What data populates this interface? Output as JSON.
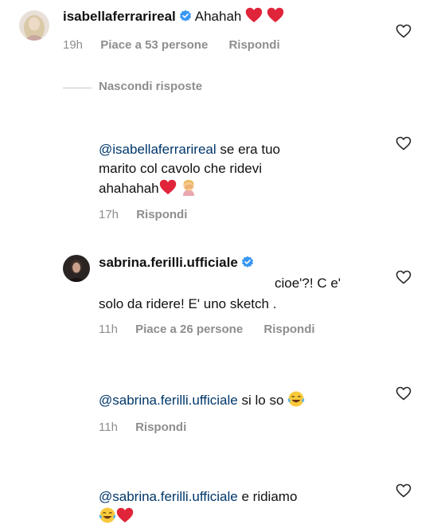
{
  "comments": [
    {
      "username": "isabellaferrarireal",
      "verified": true,
      "text": "Ahahah",
      "time": "19h",
      "likes": "Piace a 53 persone",
      "reply": "Rispondi"
    },
    {
      "mention": "@isabellaferrarireal",
      "text_line1": "se era tuo",
      "text_line2": "marito col cavolo che ridevi",
      "text_line3": "ahahahah",
      "time": "17h",
      "reply": "Rispondi"
    },
    {
      "username": "sabrina.ferilli.ufficiale",
      "verified": true,
      "text_line1": "cioe'?! C e'",
      "text_line2": "solo da ridere! E' uno sketch .",
      "time": "11h",
      "likes": "Piace a 26 persone",
      "reply": "Rispondi"
    },
    {
      "mention": "@sabrina.ferilli.ufficiale",
      "text": "si lo so",
      "time": "11h",
      "reply": "Rispondi"
    },
    {
      "mention": "@sabrina.ferilli.ufficiale",
      "text": "e ridiamo"
    }
  ],
  "hide_replies": "Nascondi risposte",
  "colors": {
    "text": "#111111",
    "mention": "#00376b",
    "meta": "#8e8e8e",
    "verified": "#3897f0",
    "heart_emoji": "#e0243a"
  },
  "icons": {
    "like": "heart-outline-icon",
    "verified": "verified-badge-icon",
    "emoji_heart": "red-heart-emoji",
    "emoji_facepalm": "facepalm-emoji",
    "emoji_laugh": "tears-of-joy-emoji"
  }
}
